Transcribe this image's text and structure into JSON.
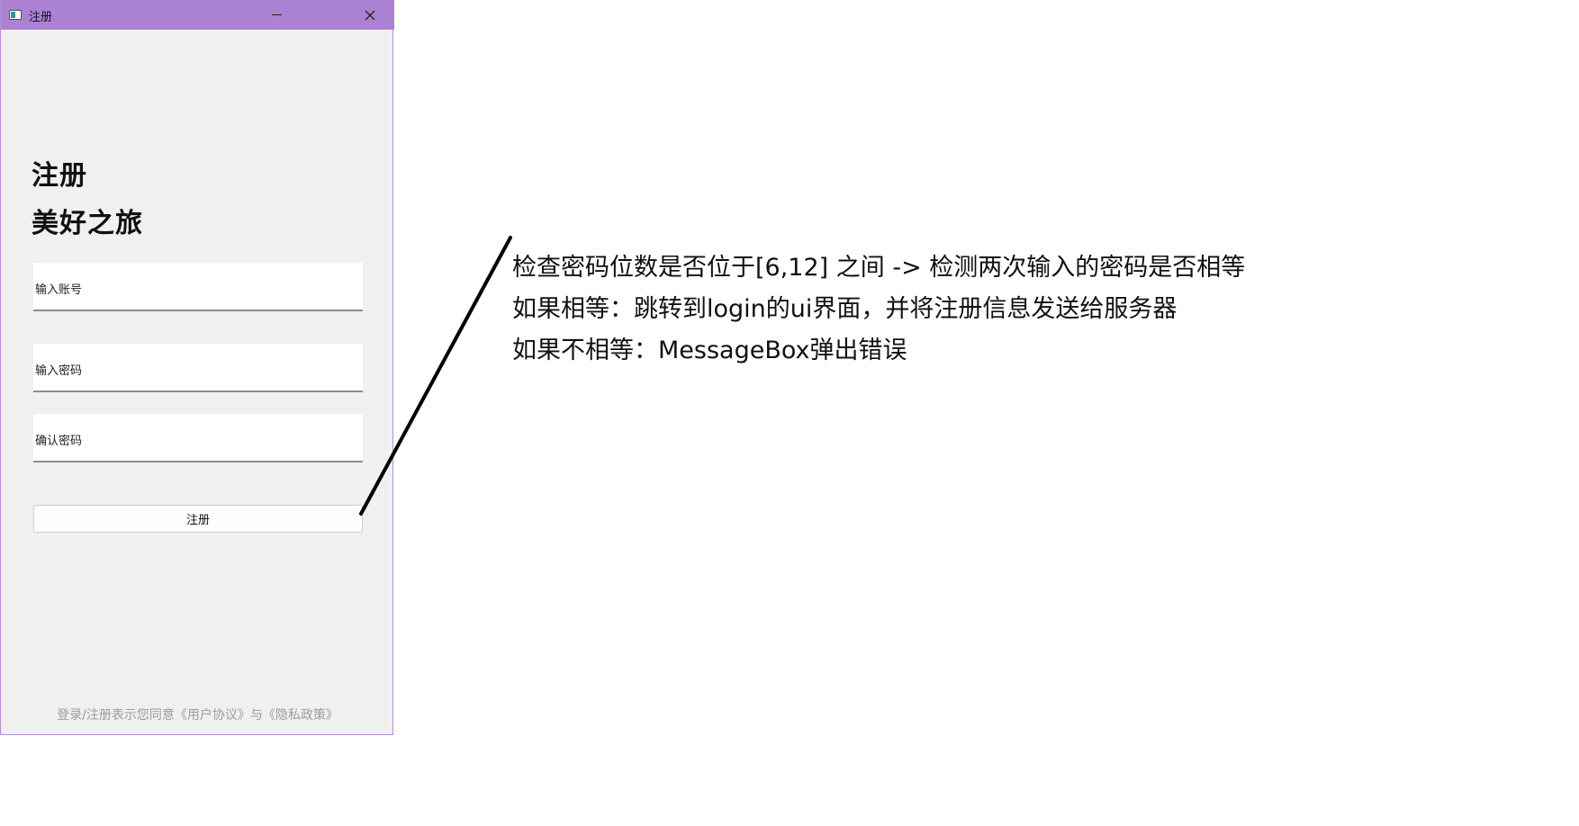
{
  "window": {
    "title": "注册",
    "controls": {
      "minimize": "minimize-icon",
      "maximize": "maximize-icon",
      "close": "close-icon"
    }
  },
  "form": {
    "heading_line1": "注册",
    "heading_line2": "美好之旅",
    "account_placeholder": "输入账号",
    "password_placeholder": "输入密码",
    "confirm_placeholder": "确认密码",
    "submit_label": "注册",
    "agreement_text": "登录/注册表示您同意《用户协议》与《隐私政策》"
  },
  "annotation": {
    "lines": [
      "检查密码位数是否位于[6,12] 之间 -> 检测两次输入的密码是否相等",
      "如果相等：跳转到login的ui界面，并将注册信息发送给服务器",
      "如果不相等：MessageBox弹出错误"
    ]
  },
  "colors": {
    "titlebar": "#ab82d3",
    "window_bg": "#f0f0f0",
    "agreement_text": "#9c9c9c"
  }
}
